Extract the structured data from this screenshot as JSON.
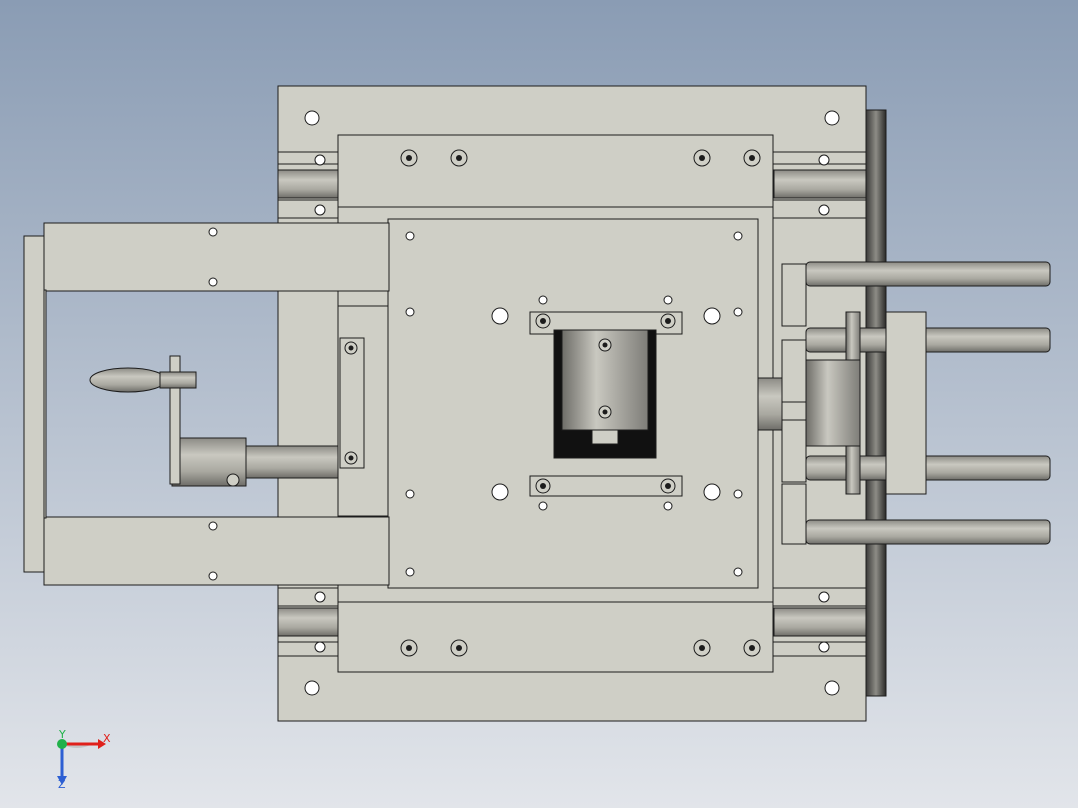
{
  "viewport": {
    "background_top": "#8a9cb4",
    "background_bottom": "#e2e5ea"
  },
  "model": {
    "fill": "#cfcfc6",
    "edge": "#1c1c1c",
    "rod_light": "#b9b8b0",
    "rod_dark": "#6e6d68",
    "dark_part": "#111111"
  },
  "triad": {
    "x_label": "X",
    "y_label": "Y",
    "z_label": "Z",
    "x_color": "#e0201b",
    "y_color": "#21b14a",
    "z_color": "#2d5fd3"
  }
}
